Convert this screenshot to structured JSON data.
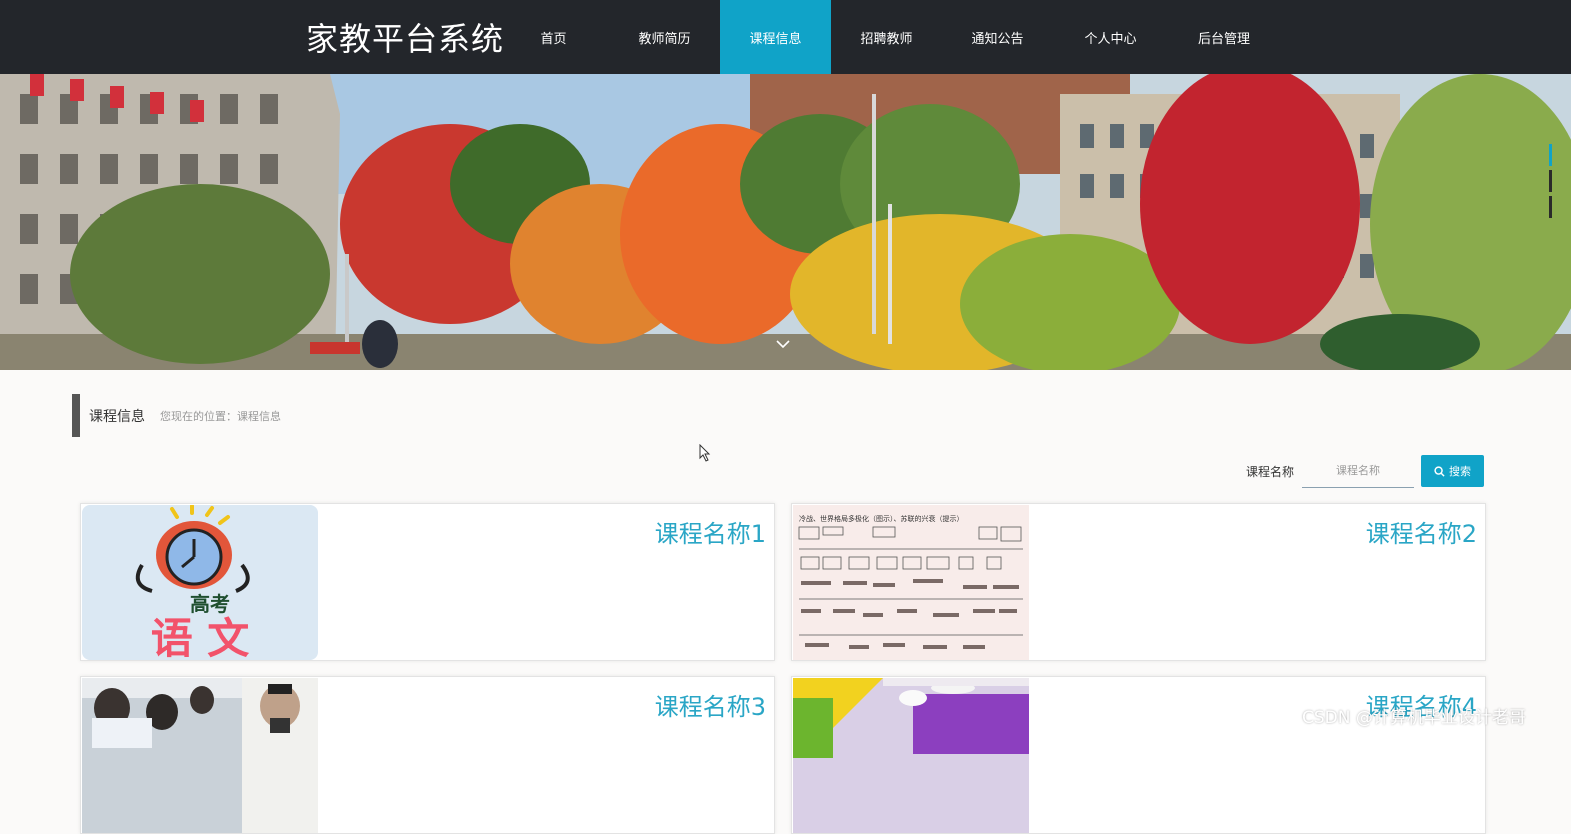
{
  "brand": {
    "title": "家教平台系统"
  },
  "nav": {
    "items": [
      {
        "label": "首页",
        "active": false
      },
      {
        "label": "教师简历",
        "active": false
      },
      {
        "label": "课程信息",
        "active": true
      },
      {
        "label": "招聘教师",
        "active": false
      },
      {
        "label": "通知公告",
        "active": false
      },
      {
        "label": "个人中心",
        "active": false
      },
      {
        "label": "后台管理",
        "active": false
      }
    ]
  },
  "banner": {
    "slides": 3,
    "active_slide": 1
  },
  "section": {
    "title": "课程信息",
    "breadcrumb": "您现在的位置：课程信息"
  },
  "search": {
    "label": "课程名称",
    "placeholder": "课程名称",
    "button_label": "搜索"
  },
  "courses": [
    {
      "name": "课程名称1",
      "image": "高考语文 alarm clock"
    },
    {
      "name": "课程名称2",
      "image": "history timeline chart"
    },
    {
      "name": "课程名称3",
      "image": "classroom students"
    },
    {
      "name": "课程名称4",
      "image": "colorful classroom"
    }
  ],
  "card_images": {
    "gaokao": "高考",
    "yuwen": "语 文",
    "timeline_title": "冷战、世界格局多极化（图示）、苏联的兴衰（提示）"
  },
  "watermark": "CSDN @计算机毕业设计老哥",
  "colors": {
    "accent": "#10a3c8",
    "nav_bg": "#23262b",
    "title": "#2aa6c6"
  }
}
